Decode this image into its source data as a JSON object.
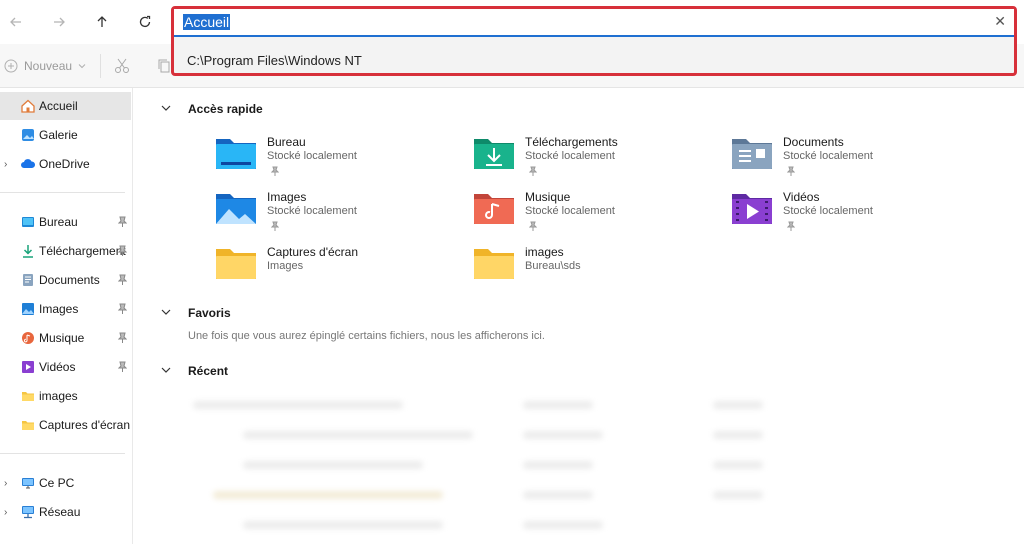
{
  "nav": {
    "back_icon": "arrow-left-icon",
    "forward_icon": "arrow-right-icon",
    "up_icon": "arrow-up-icon",
    "refresh_icon": "refresh-icon"
  },
  "toolbar": {
    "new_label": "Nouveau"
  },
  "address": {
    "value": "Accueil",
    "suggestion": "C:\\Program Files\\Windows NT",
    "accent_color": "#1f6fd1",
    "highlight_border": "#d7303a"
  },
  "sidebar": {
    "items": [
      {
        "label": "Accueil",
        "icon": "home-icon",
        "active": true
      },
      {
        "label": "Galerie",
        "icon": "gallery-icon"
      },
      {
        "label": "OneDrive",
        "icon": "cloud-icon",
        "expandable": true
      },
      {
        "label": "Bureau",
        "icon": "desktop-icon",
        "pinned": true
      },
      {
        "label": "Téléchargement",
        "icon": "download-icon",
        "pinned": true
      },
      {
        "label": "Documents",
        "icon": "document-icon",
        "pinned": true
      },
      {
        "label": "Images",
        "icon": "image-icon",
        "pinned": true
      },
      {
        "label": "Musique",
        "icon": "music-icon",
        "pinned": true
      },
      {
        "label": "Vidéos",
        "icon": "video-icon",
        "pinned": true
      },
      {
        "label": "images",
        "icon": "folder-icon"
      },
      {
        "label": "Captures d'écran",
        "icon": "folder-icon"
      },
      {
        "label": "Ce PC",
        "icon": "computer-icon",
        "expandable": true
      },
      {
        "label": "Réseau",
        "icon": "network-icon",
        "expandable": true
      }
    ]
  },
  "main": {
    "quick_access": {
      "title": "Accès rapide",
      "tiles": [
        {
          "name": "Bureau",
          "sub": "Stocké localement",
          "pinned": true,
          "icon": "desktop-folder-icon"
        },
        {
          "name": "Téléchargements",
          "sub": "Stocké localement",
          "pinned": true,
          "icon": "downloads-folder-icon"
        },
        {
          "name": "Documents",
          "sub": "Stocké localement",
          "pinned": true,
          "icon": "documents-folder-icon"
        },
        {
          "name": "Images",
          "sub": "Stocké localement",
          "pinned": true,
          "icon": "pictures-folder-icon"
        },
        {
          "name": "Musique",
          "sub": "Stocké localement",
          "pinned": true,
          "icon": "music-folder-icon"
        },
        {
          "name": "Vidéos",
          "sub": "Stocké localement",
          "pinned": true,
          "icon": "videos-folder-icon"
        },
        {
          "name": "Captures d'écran",
          "sub": "Images",
          "pinned": false,
          "icon": "folder-icon"
        },
        {
          "name": "images",
          "sub": "Bureau\\sds",
          "pinned": false,
          "icon": "folder-icon"
        }
      ]
    },
    "favorites": {
      "title": "Favoris",
      "hint": "Une fois que vous aurez épinglé certains fichiers, nous les afficherons ici."
    },
    "recent": {
      "title": "Récent"
    }
  }
}
